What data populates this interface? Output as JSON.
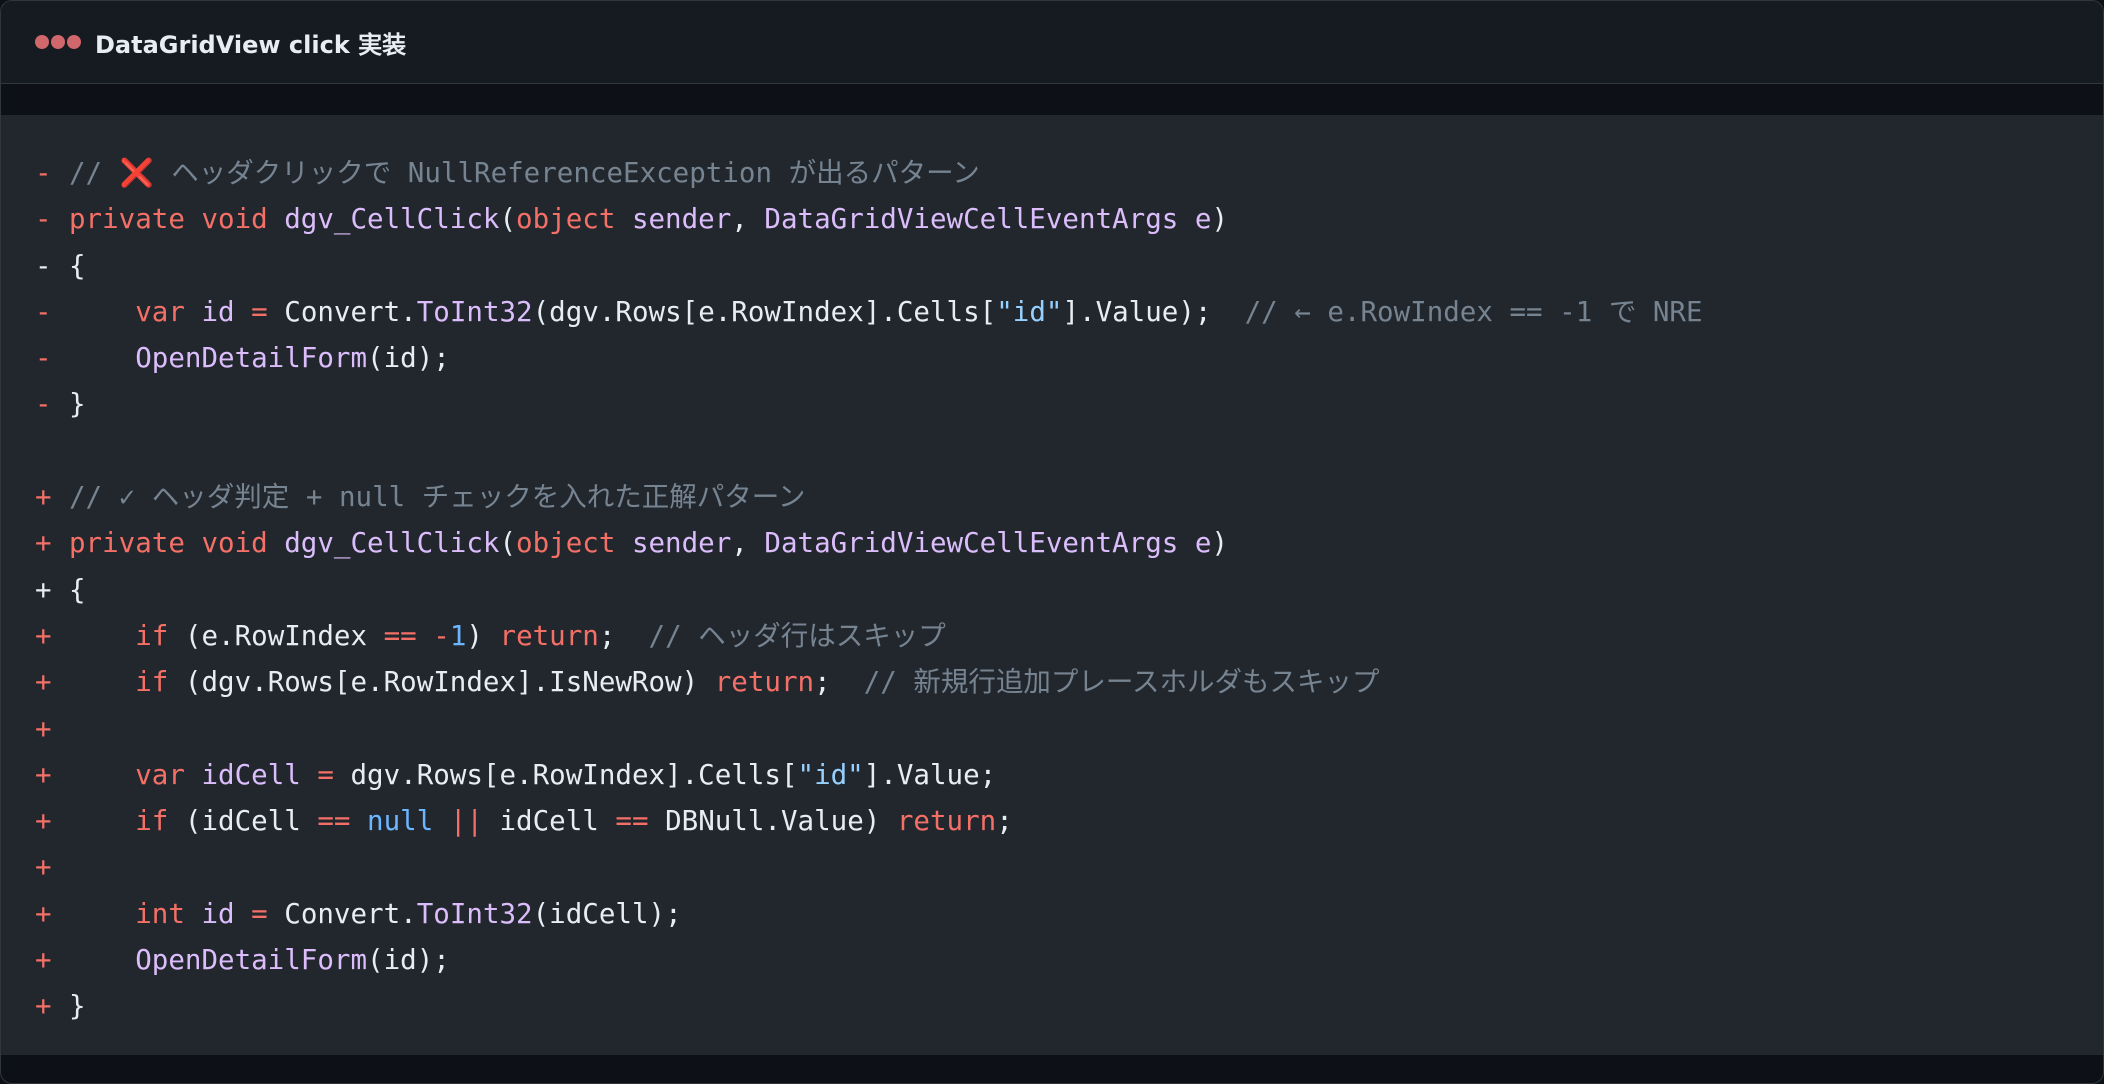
{
  "window": {
    "title": "DataGridView click 実装",
    "accent_dot_color": "#d0676b"
  },
  "colors": {
    "background": "#22272e",
    "removed_marker": "#f47067",
    "keyword": "#f47067",
    "function": "#dcbdfb",
    "comment": "#768390",
    "string": "#96d0ff",
    "number": "#6cb6ff"
  },
  "code": {
    "lines": [
      {
        "marker": "-",
        "tokens": [
          {
            "t": "// ",
            "c": "cm"
          },
          {
            "icon": "cross-mark-icon",
            "t": "❌"
          },
          {
            "t": " ヘッダクリックで NullReferenceException が出るパターン",
            "c": "cm"
          }
        ]
      },
      {
        "marker": "-",
        "tokens": [
          {
            "t": "private void ",
            "c": "kw"
          },
          {
            "t": "dgv_CellClick",
            "c": "fn"
          },
          {
            "t": "(",
            "c": "pl"
          },
          {
            "t": "object ",
            "c": "kw"
          },
          {
            "t": "sender",
            "c": "fn"
          },
          {
            "t": ", ",
            "c": "pl"
          },
          {
            "t": "DataGridViewCellEventArgs ",
            "c": "fn"
          },
          {
            "t": "e",
            "c": "fn"
          },
          {
            "t": ")",
            "c": "pl"
          }
        ]
      },
      {
        "marker": "-",
        "marker_plain": true,
        "tokens": [
          {
            "t": "{",
            "c": "pl"
          }
        ]
      },
      {
        "marker": "-",
        "tokens": [
          {
            "t": "    ",
            "c": "pl"
          },
          {
            "t": "var ",
            "c": "kw"
          },
          {
            "t": "id",
            "c": "fn"
          },
          {
            "t": " = ",
            "c": "kw"
          },
          {
            "t": "Convert.",
            "c": "pl"
          },
          {
            "t": "ToInt32",
            "c": "fn"
          },
          {
            "t": "(dgv.Rows[e.RowIndex].Cells[",
            "c": "pl"
          },
          {
            "t": "\"id\"",
            "c": "st"
          },
          {
            "t": "].Value);  ",
            "c": "pl"
          },
          {
            "t": "// ← e.RowIndex == -1 で NRE",
            "c": "cm"
          }
        ]
      },
      {
        "marker": "-",
        "tokens": [
          {
            "t": "    ",
            "c": "pl"
          },
          {
            "t": "OpenDetailForm",
            "c": "fn"
          },
          {
            "t": "(id);",
            "c": "pl"
          }
        ]
      },
      {
        "marker": "-",
        "tokens": [
          {
            "t": "}",
            "c": "pl"
          }
        ]
      },
      {
        "marker": "",
        "tokens": []
      },
      {
        "marker": "+",
        "tokens": [
          {
            "t": "// ✓ ヘッダ判定 + null チェックを入れた正解パターン",
            "c": "cm"
          }
        ]
      },
      {
        "marker": "+",
        "tokens": [
          {
            "t": "private void ",
            "c": "kw"
          },
          {
            "t": "dgv_CellClick",
            "c": "fn"
          },
          {
            "t": "(",
            "c": "pl"
          },
          {
            "t": "object ",
            "c": "kw"
          },
          {
            "t": "sender",
            "c": "fn"
          },
          {
            "t": ", ",
            "c": "pl"
          },
          {
            "t": "DataGridViewCellEventArgs ",
            "c": "fn"
          },
          {
            "t": "e",
            "c": "fn"
          },
          {
            "t": ")",
            "c": "pl"
          }
        ]
      },
      {
        "marker": "+",
        "marker_plain": true,
        "tokens": [
          {
            "t": "{",
            "c": "pl"
          }
        ]
      },
      {
        "marker": "+",
        "tokens": [
          {
            "t": "    ",
            "c": "pl"
          },
          {
            "t": "if ",
            "c": "kw"
          },
          {
            "t": "(e.RowIndex ",
            "c": "pl"
          },
          {
            "t": "== -",
            "c": "kw"
          },
          {
            "t": "1",
            "c": "nu"
          },
          {
            "t": ") ",
            "c": "pl"
          },
          {
            "t": "return",
            "c": "kw"
          },
          {
            "t": ";  ",
            "c": "pl"
          },
          {
            "t": "// ヘッダ行はスキップ",
            "c": "cm"
          }
        ]
      },
      {
        "marker": "+",
        "tokens": [
          {
            "t": "    ",
            "c": "pl"
          },
          {
            "t": "if ",
            "c": "kw"
          },
          {
            "t": "(dgv.Rows[e.RowIndex].IsNewRow) ",
            "c": "pl"
          },
          {
            "t": "return",
            "c": "kw"
          },
          {
            "t": ";  ",
            "c": "pl"
          },
          {
            "t": "// 新規行追加プレースホルダもスキップ",
            "c": "cm"
          }
        ]
      },
      {
        "marker": "+",
        "tokens": []
      },
      {
        "marker": "+",
        "tokens": [
          {
            "t": "    ",
            "c": "pl"
          },
          {
            "t": "var ",
            "c": "kw"
          },
          {
            "t": "idCell",
            "c": "fn"
          },
          {
            "t": " = ",
            "c": "kw"
          },
          {
            "t": "dgv.Rows[e.RowIndex].Cells[",
            "c": "pl"
          },
          {
            "t": "\"id\"",
            "c": "st"
          },
          {
            "t": "].Value;",
            "c": "pl"
          }
        ]
      },
      {
        "marker": "+",
        "tokens": [
          {
            "t": "    ",
            "c": "pl"
          },
          {
            "t": "if ",
            "c": "kw"
          },
          {
            "t": "(idCell ",
            "c": "pl"
          },
          {
            "t": "== ",
            "c": "kw"
          },
          {
            "t": "null ",
            "c": "nu"
          },
          {
            "t": "|| ",
            "c": "kw"
          },
          {
            "t": "idCell ",
            "c": "pl"
          },
          {
            "t": "== ",
            "c": "kw"
          },
          {
            "t": "DBNull.Value) ",
            "c": "pl"
          },
          {
            "t": "return",
            "c": "kw"
          },
          {
            "t": ";",
            "c": "pl"
          }
        ]
      },
      {
        "marker": "+",
        "tokens": []
      },
      {
        "marker": "+",
        "tokens": [
          {
            "t": "    ",
            "c": "pl"
          },
          {
            "t": "int ",
            "c": "kw"
          },
          {
            "t": "id",
            "c": "fn"
          },
          {
            "t": " = ",
            "c": "kw"
          },
          {
            "t": "Convert.",
            "c": "pl"
          },
          {
            "t": "ToInt32",
            "c": "fn"
          },
          {
            "t": "(idCell);",
            "c": "pl"
          }
        ]
      },
      {
        "marker": "+",
        "tokens": [
          {
            "t": "    ",
            "c": "pl"
          },
          {
            "t": "OpenDetailForm",
            "c": "fn"
          },
          {
            "t": "(id);",
            "c": "pl"
          }
        ]
      },
      {
        "marker": "+",
        "tokens": [
          {
            "t": "}",
            "c": "pl"
          }
        ]
      }
    ]
  }
}
